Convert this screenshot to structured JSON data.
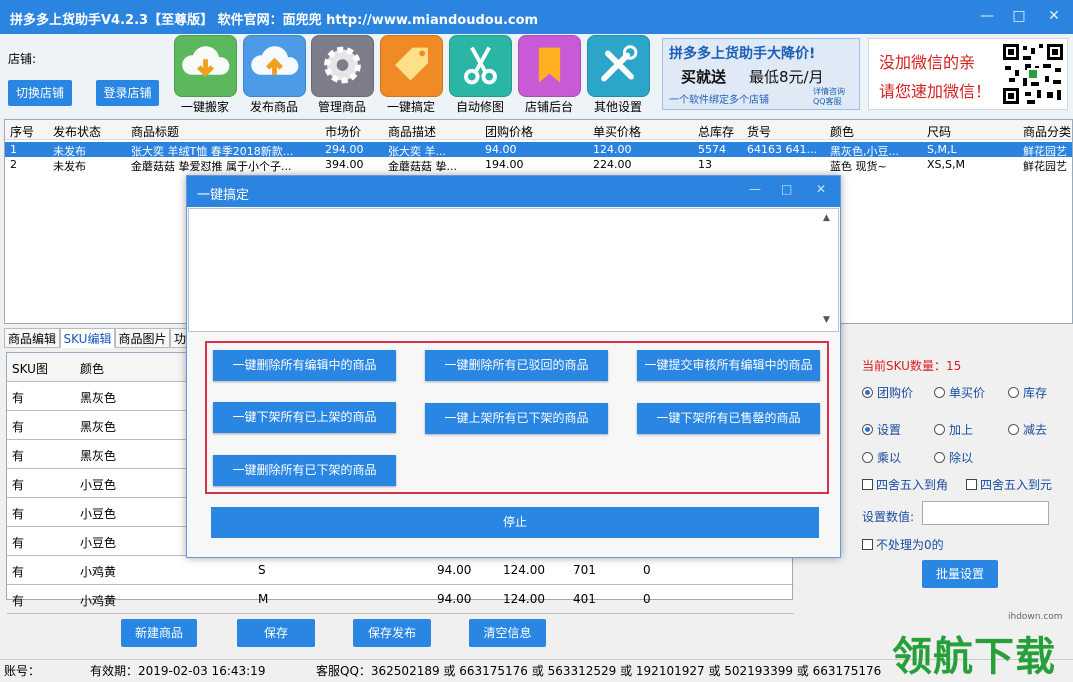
{
  "app": {
    "title": "拼多多上货助手V4.2.3【至尊版】 软件官网：面兜兜 http://www.miandoudou.com",
    "win_min": "—",
    "win_max": "□",
    "win_close": "✕"
  },
  "top": {
    "shop_label": "店铺:",
    "switch_shop": "切换店铺",
    "login_shop": "登录店铺",
    "tools": [
      {
        "label": "一键搬家",
        "icon": "download-cloud-icon",
        "color": "#5cb85c"
      },
      {
        "label": "发布商品",
        "icon": "upload-cloud-icon",
        "color": "#4d9be6"
      },
      {
        "label": "管理商品",
        "icon": "gear-icon",
        "color": "#7d7d8a"
      },
      {
        "label": "一键搞定",
        "icon": "tag-icon",
        "color": "#f08a24"
      },
      {
        "label": "自动修图",
        "icon": "scissors-icon",
        "color": "#2bb5a4"
      },
      {
        "label": "店铺后台",
        "icon": "bookmark-icon",
        "color": "#c95ad6"
      },
      {
        "label": "其他设置",
        "icon": "tools-icon",
        "color": "#2ba6c8"
      }
    ],
    "banner": {
      "line1": "拼多多上货助手大降价!",
      "line2a": "买就送",
      "line2b": "最低8元/月",
      "line3": "一个软件绑定多个店铺",
      "badge": "详情咨询 QQ客服"
    },
    "wechat": {
      "line1": "没加微信的亲",
      "line2": "请您速加微信！"
    }
  },
  "product_table": {
    "headers": [
      "序号",
      "发布状态",
      "商品标题",
      "市场价",
      "商品描述",
      "团购价格",
      "单买价格",
      "总库存",
      "货号",
      "颜色",
      "尺码",
      "商品分类"
    ],
    "rows": [
      [
        "1",
        "未发布",
        "张大奕 羊绒T恤 春季2018新款...",
        "294.00",
        "张大奕 羊...",
        "94.00",
        "124.00",
        "5574",
        "64163 641...",
        "黑灰色,小豆...",
        "S,M,L",
        "鲜花园艺"
      ],
      [
        "2",
        "未发布",
        "金蘑菇菇 挚爱怼推 属于小个子...",
        "394.00",
        "金蘑菇菇 挚...",
        "194.00",
        "224.00",
        "13",
        "",
        "蓝色 现货~",
        "XS,S,M",
        "鲜花园艺"
      ]
    ]
  },
  "tabs": [
    "商品编辑",
    "SKU编辑",
    "商品图片",
    "功"
  ],
  "sku_table": {
    "headers": [
      "SKU图",
      "颜色"
    ],
    "rows": [
      [
        "有",
        "黑灰色",
        "",
        "",
        "",
        "",
        ""
      ],
      [
        "有",
        "黑灰色",
        "",
        "",
        "",
        "",
        ""
      ],
      [
        "有",
        "黑灰色",
        "",
        "",
        "",
        "",
        ""
      ],
      [
        "有",
        "小豆色",
        "",
        "",
        "",
        "",
        ""
      ],
      [
        "有",
        "小豆色",
        "",
        "",
        "",
        "",
        ""
      ],
      [
        "有",
        "小豆色",
        "",
        "",
        "",
        "",
        ""
      ],
      [
        "有",
        "小鸡黄",
        "S",
        "94.00",
        "124.00",
        "701",
        "0"
      ],
      [
        "有",
        "小鸡黄",
        "M",
        "94.00",
        "124.00",
        "401",
        "0"
      ]
    ]
  },
  "right_panel": {
    "sku_count_label": "当前SKU数量：15",
    "price_radios": [
      "团购价",
      "单买价",
      "库存"
    ],
    "op_radios": [
      "设置",
      "加上",
      "减去",
      "乘以",
      "除以"
    ],
    "round_jiao": "四舍五入到角",
    "round_yuan": "四舍五入到元",
    "set_value_label": "设置数值:",
    "set_value": "",
    "skip_zero": "不处理为0的",
    "batch_btn": "批量设置"
  },
  "bottom_buttons": [
    "新建商品",
    "保存",
    "保存发布",
    "清空信息"
  ],
  "status": {
    "account": "账号：",
    "expire": "有效期：2019-02-03 16:43:19",
    "qq": "客服QQ：362502189 或 663175176 或 563312529 或 192101927 或 502193399 或 663175176"
  },
  "dialog": {
    "title": "一键搞定",
    "log": "",
    "actions": [
      "一键删除所有编辑中的商品",
      "一键删除所有已驳回的商品",
      "一键提交审核所有编辑中的商品",
      "一键下架所有已上架的商品",
      "一键上架所有已下架的商品",
      "一键下架所有已售罄的商品",
      "一键删除所有已下架的商品"
    ],
    "stop": "停止"
  },
  "watermark": {
    "site": "ihdown.com",
    "text": "领航下载"
  }
}
